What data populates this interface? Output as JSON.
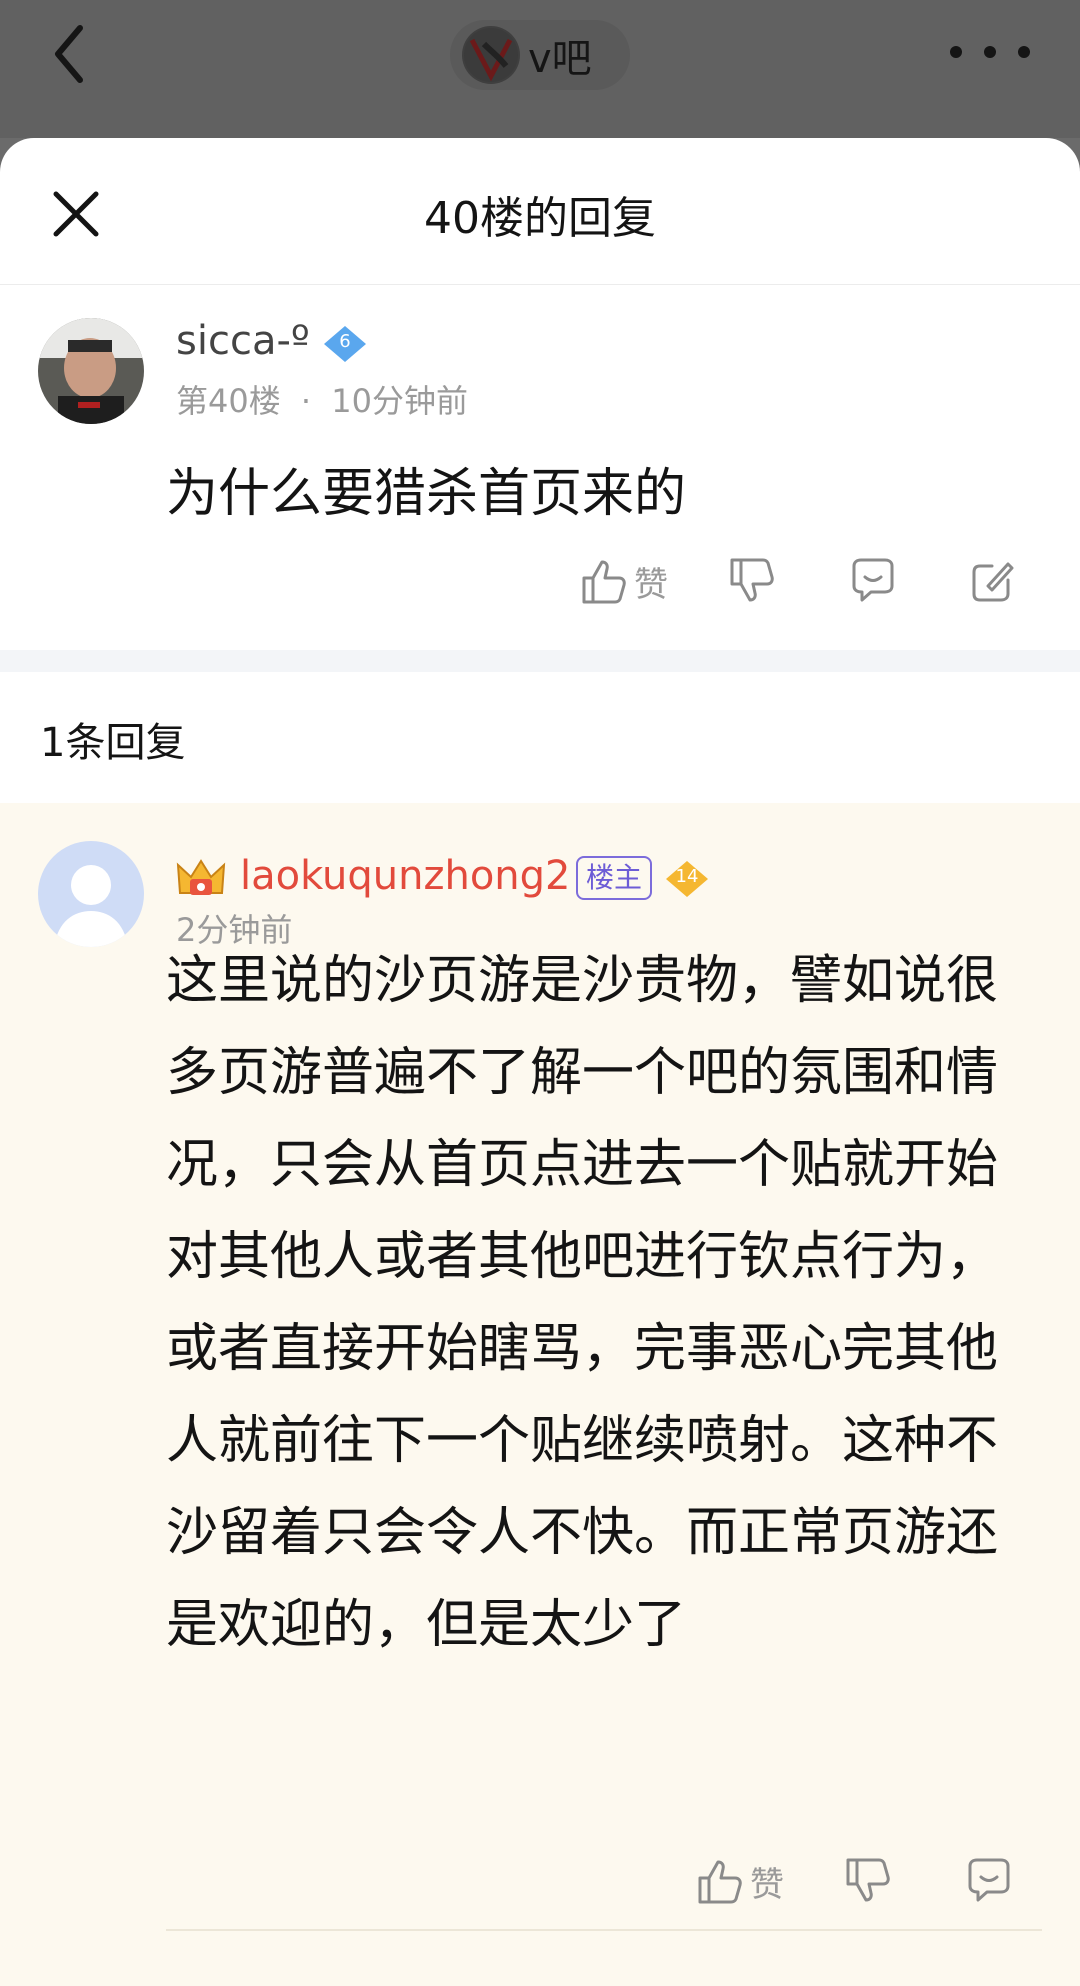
{
  "top_bar": {
    "forum_name": "v吧",
    "back_icon": "chevron-left-icon",
    "more_icon": "more-dots-icon"
  },
  "sheet": {
    "title": "40楼的回复",
    "close_icon": "close-icon"
  },
  "post": {
    "username": "sicca-º",
    "level": "6",
    "floor": "第40楼",
    "dot": "·",
    "time": "10分钟前",
    "content": "为什么要猎杀首页来的",
    "like_label": "赞"
  },
  "replies": {
    "count_label": "1条回复",
    "items": [
      {
        "username": "laokuqunzhong2",
        "owner_badge": "楼主",
        "level": "14",
        "time": "2分钟前",
        "content": "这里说的沙页游是沙贵物，譬如说很多页游普遍不了解一个吧的氛围和情况，只会从首页点进去一个贴就开始对其他人或者其他吧进行钦点行为，或者直接开始瞎骂，完事恶心完其他人就前往下一个贴继续喷射。这种不沙留着只会令人不快。而正常页游还是欢迎的，但是太少了",
        "like_label": "赞"
      }
    ]
  },
  "colors": {
    "accent_red": "#e24a3c",
    "owner_badge": "#6d5cd6",
    "level_blue": "#5aa7ee",
    "level_gold": "#f5b731",
    "reply_bg": "#fdf9ef"
  }
}
